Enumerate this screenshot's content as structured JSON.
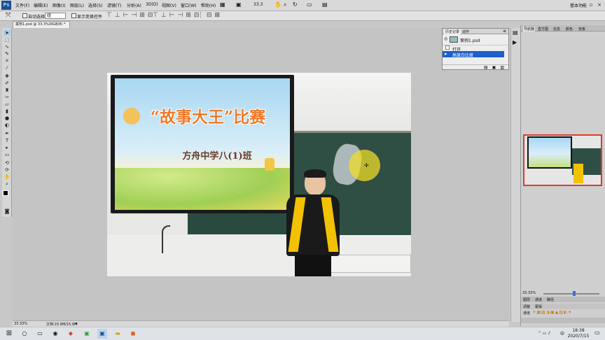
{
  "app": {
    "logo_text": "Ps"
  },
  "menubar": {
    "items": [
      "文件(F)",
      "编辑(E)",
      "图像(I)",
      "图层(L)",
      "选择(S)",
      "滤镜(T)",
      "分析(A)",
      "3D(D)",
      "视图(V)",
      "窗口(W)",
      "帮助(H)"
    ],
    "zoom_value": "33.3",
    "workspace": "基本功能"
  },
  "options_bar": {
    "auto_select_label": "自动选择:",
    "auto_select_value": "组",
    "show_transform_label": "显示变换控件"
  },
  "document": {
    "tab_title": "案例1.psd @ 33.3%(RGB/8) *",
    "slide_title": "“故事大王”比赛",
    "slide_subtitle": "方舟中学八(1)班"
  },
  "history_panel": {
    "tabs": [
      "历史记录",
      "动作"
    ],
    "snapshot_label": "案例1.psd",
    "items": [
      "打开",
      "高度白比度"
    ]
  },
  "navigator": {
    "tabs": [
      "导航器",
      "直方图",
      "信息",
      "颜色",
      "色板"
    ],
    "zoom": "33.33%"
  },
  "lower_panels": {
    "tabs1": [
      "图层",
      "通道",
      "路径"
    ],
    "tabs2": [
      "调整",
      "蒙版"
    ],
    "tabs3": [
      "通道"
    ]
  },
  "status": {
    "zoom": "33.33%",
    "doc_info": "文档:15.9M/15.9M"
  },
  "taskbar": {
    "time": "18:38",
    "date": "2020/7/15",
    "ime": "中"
  },
  "colors": {
    "selection_blue": "#1e5fc9",
    "navigator_frame": "#e03a2a"
  }
}
